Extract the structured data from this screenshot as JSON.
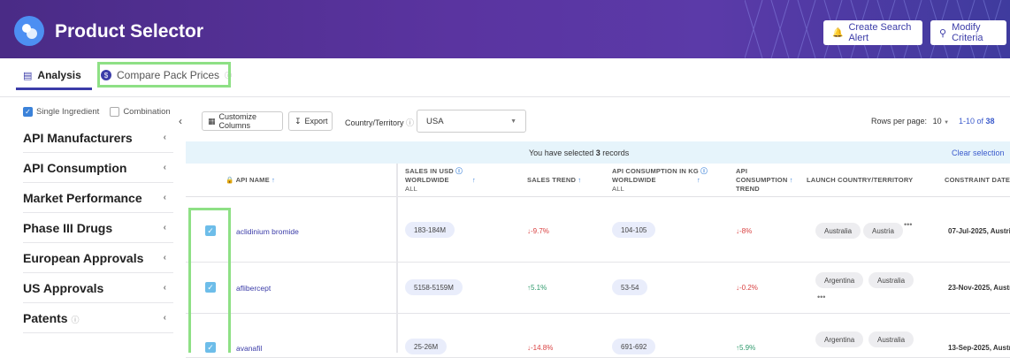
{
  "header": {
    "title": "Product Selector",
    "create_alert_label": "Create Search Alert",
    "modify_criteria_label": "Modify Criteria"
  },
  "tabs": {
    "analysis_label": "Analysis",
    "compare_label": "Compare Pack Prices"
  },
  "sidebar": {
    "single_ingredient_label": "Single Ingredient",
    "combination_label": "Combination",
    "items": [
      {
        "label": "API Manufacturers"
      },
      {
        "label": "API Consumption"
      },
      {
        "label": "Market Performance"
      },
      {
        "label": "Phase III Drugs"
      },
      {
        "label": "European Approvals"
      },
      {
        "label": "US Approvals"
      },
      {
        "label": "Patents"
      }
    ]
  },
  "toolbar": {
    "customize_label": "Customize Columns",
    "export_label": "Export",
    "country_label": "Country/Territory",
    "country_value": "USA",
    "rows_per_page_label": "Rows per page:",
    "rows_per_page_value": "10",
    "pager_range": "1-10 of ",
    "pager_total": "38"
  },
  "selection": {
    "prefix": "You have selected ",
    "count": "3",
    "suffix": " records",
    "clear_label": "Clear selection"
  },
  "table": {
    "headers": {
      "api_name": "API NAME",
      "sales_l1": "SALES IN USD",
      "sales_l2": "WORLDWIDE",
      "sales_l3": "ALL",
      "sales_trend": "SALES TREND",
      "cons_l1": "API CONSUMPTION IN KG",
      "cons_l2": "WORLDWIDE",
      "cons_l3": "ALL",
      "ctrend_l1": "API",
      "ctrend_l2": "CONSUMPTION",
      "ctrend_l3": "TREND",
      "launch": "LAUNCH COUNTRY/TERRITORY",
      "constraint": "CONSTRAINT DATE FO"
    },
    "rows": [
      {
        "name": "aclidinium bromide",
        "sales": "183-184M",
        "sales_trend": "-9.7%",
        "consumption": "104-105",
        "cons_trend": "-8%",
        "countries": [
          "Australia",
          "Austria"
        ],
        "date": "07-Jul-2025, Austri"
      },
      {
        "name": "aflibercept",
        "sales": "5158-5159M",
        "sales_trend": "5.1%",
        "consumption": "53-54",
        "cons_trend": "-0.2%",
        "countries": [
          "Argentina",
          "Australia"
        ],
        "date": "23-Nov-2025, Austr"
      },
      {
        "name": "avanafil",
        "sales": "25-26M",
        "sales_trend": "-14.8%",
        "consumption": "691-692",
        "cons_trend": "5.9%",
        "countries": [
          "Argentina",
          "Australia"
        ],
        "date": "13-Sep-2025, Austr"
      }
    ]
  },
  "colors": {
    "header_bg": "#4a2b86",
    "accent": "#3b3ca8",
    "highlight": "#8ee085",
    "trend_down": "#d94040",
    "trend_up": "#2f9a6c"
  }
}
